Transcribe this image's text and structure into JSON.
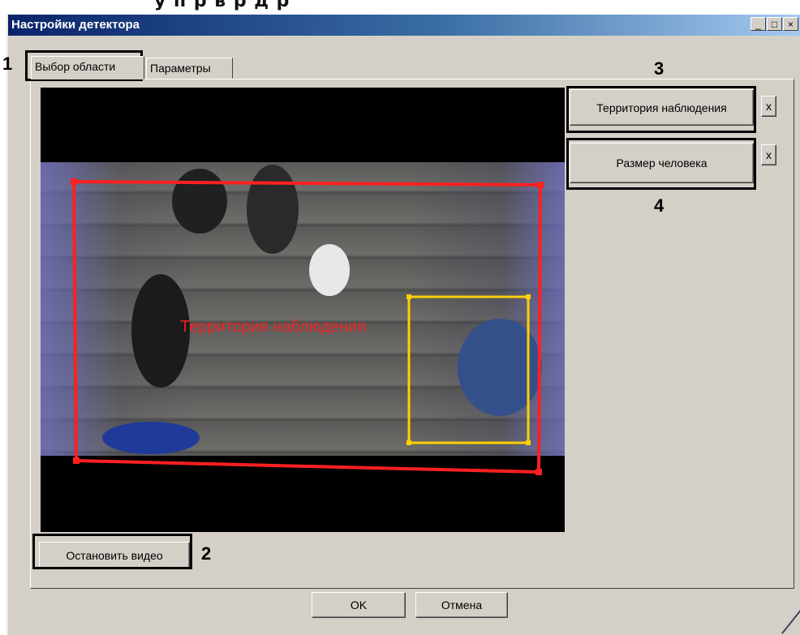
{
  "window": {
    "title": "Настройки детектора",
    "controls": {
      "minimize": "_",
      "maximize": "□",
      "close": "×"
    }
  },
  "tabs": [
    {
      "label": "Выбор области",
      "active": true
    },
    {
      "label": "Параметры",
      "active": false
    }
  ],
  "video": {
    "zone_label": "Территория наблюдения",
    "zone_color": "#ff2020",
    "person_box_color": "#ffd000"
  },
  "zone_buttons": [
    {
      "label": "Территория наблюдения",
      "remove": "x"
    },
    {
      "label": "Размер человека",
      "remove": "x"
    }
  ],
  "stop_video_label": "Остановить видео",
  "dialog_buttons": {
    "ok": "OK",
    "cancel": "Отмена"
  },
  "callouts": [
    "1",
    "2",
    "3",
    "4"
  ]
}
